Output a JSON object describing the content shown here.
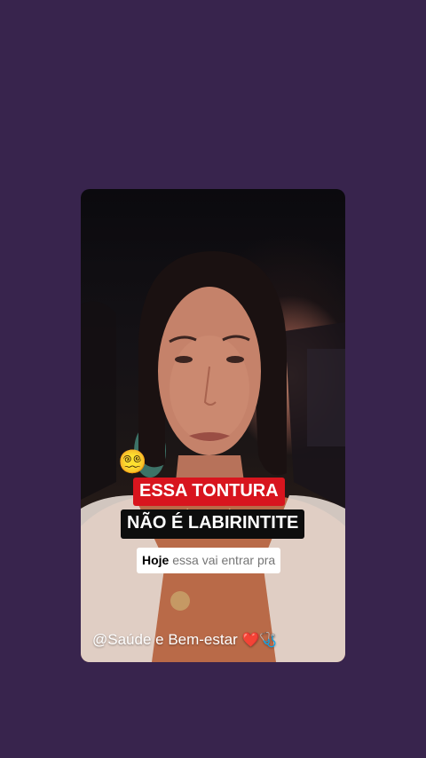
{
  "story": {
    "emoji": "😵‍💫",
    "caption_line1": "ESSA TONTURA",
    "caption_line2": "NÃO É LABIRINTITE",
    "subtitle_highlight": "Hoje",
    "subtitle_rest": " essa vai entrar pra",
    "handle_text": "@Saúde e Bem-estar ",
    "handle_emojis": "❤️🩺"
  },
  "colors": {
    "background": "#38244d",
    "caption_red": "#d8151e",
    "caption_dark": "#0d0d0d"
  }
}
